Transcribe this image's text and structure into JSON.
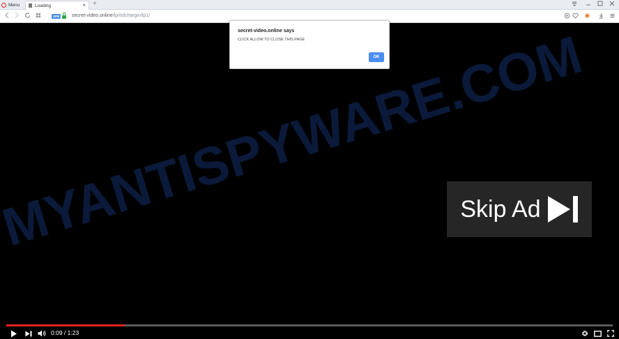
{
  "browser": {
    "menu_label": "Menu",
    "tab_title": "Loading",
    "tab_close": "×",
    "new_tab": "+",
    "vpn_label": "VPN",
    "url_host": "secret-video.online",
    "url_path": "/lp/edchargin/lp1/"
  },
  "video": {
    "watermark_text": "MYANTISPYWARE.COM",
    "skip_ad_label": "Skip Ad",
    "time_display": "0:09 / 1:23",
    "progress_fraction": 0.195
  },
  "dialog": {
    "title": "secret-video.online says",
    "message": "CLICK ALLOW TO CLOSE THIS PAGE",
    "ok_label": "OK"
  },
  "colors": {
    "progress": "#e1241b",
    "ok_button": "#4a8df0",
    "watermark": "#0b1a3a"
  }
}
